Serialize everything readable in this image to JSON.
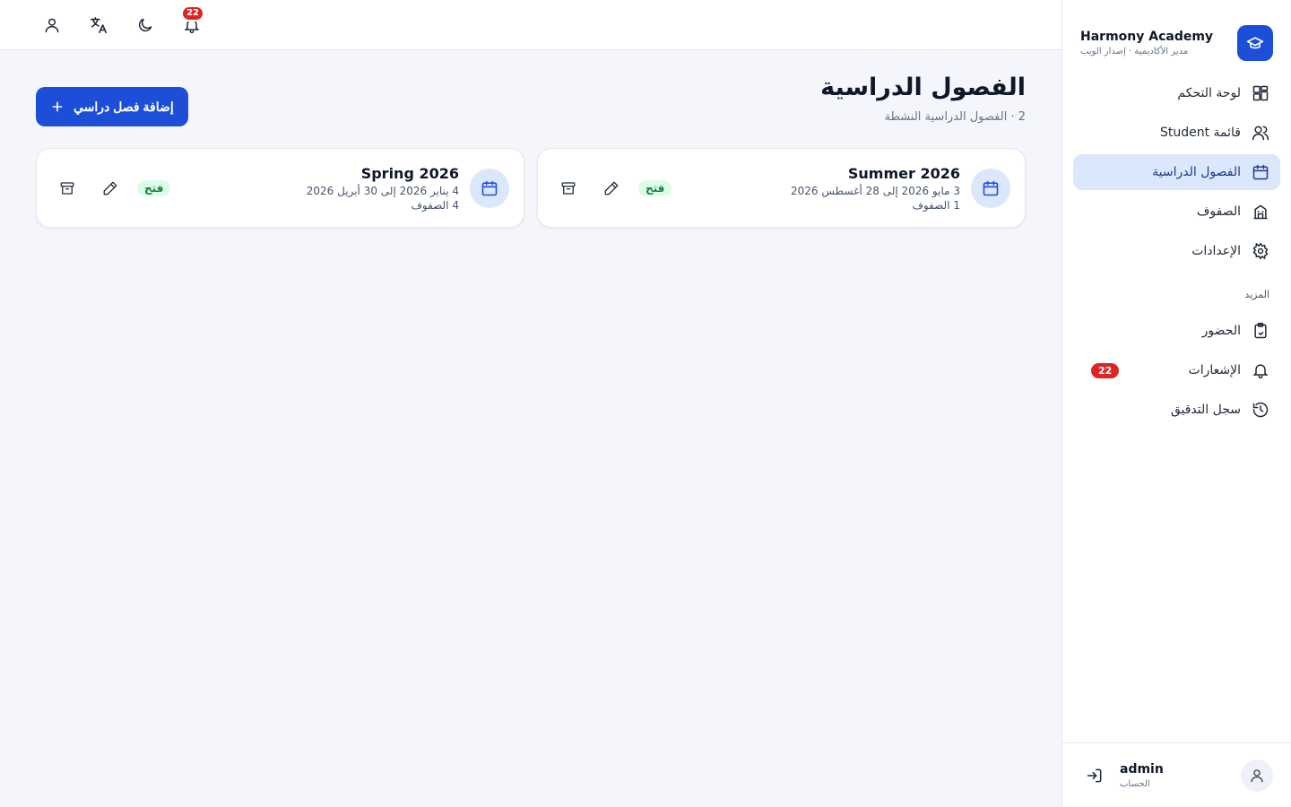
{
  "brand": {
    "name": "Harmony Academy",
    "subtitle": "مدير الأكاديمية · إصدار الويب"
  },
  "nav": {
    "items": [
      {
        "label": "لوحة التحكم",
        "icon": "dashboard-icon"
      },
      {
        "label": "قائمة Student",
        "icon": "users-icon"
      },
      {
        "label": "الفصول الدراسية",
        "icon": "calendar-icon",
        "active": true
      },
      {
        "label": "الصفوف",
        "icon": "building-icon"
      },
      {
        "label": "الإعدادات",
        "icon": "gear-icon"
      }
    ],
    "more_label": "المزيد",
    "more_items": [
      {
        "label": "الحضور",
        "icon": "clipboard-icon"
      },
      {
        "label": "الإشعارات",
        "icon": "bell-icon",
        "badge": "22"
      },
      {
        "label": "سجل التدقيق",
        "icon": "history-icon"
      }
    ]
  },
  "account": {
    "name": "admin",
    "sub": "الحساب"
  },
  "topbar": {
    "notifications_badge": "22"
  },
  "page": {
    "title": "الفصول الدراسية",
    "subtitle": "2 · الفصول الدراسية النشطة",
    "add_button": "إضافة فصل دراسي"
  },
  "terms": [
    {
      "name": "Summer 2026",
      "dates": "3 مايو 2026 إلى 28 أغسطس 2026",
      "count": "1 الصفوف",
      "status": "فتح"
    },
    {
      "name": "Spring 2026",
      "dates": "4 يناير 2026 إلى 30 أبريل 2026",
      "count": "4 الصفوف",
      "status": "فتح"
    }
  ],
  "colors": {
    "primary": "#1d4ed8",
    "active_bg": "#dbe7fb",
    "badge": "#dc2626",
    "status_bg": "#dcfce7",
    "status_fg": "#15803d"
  }
}
